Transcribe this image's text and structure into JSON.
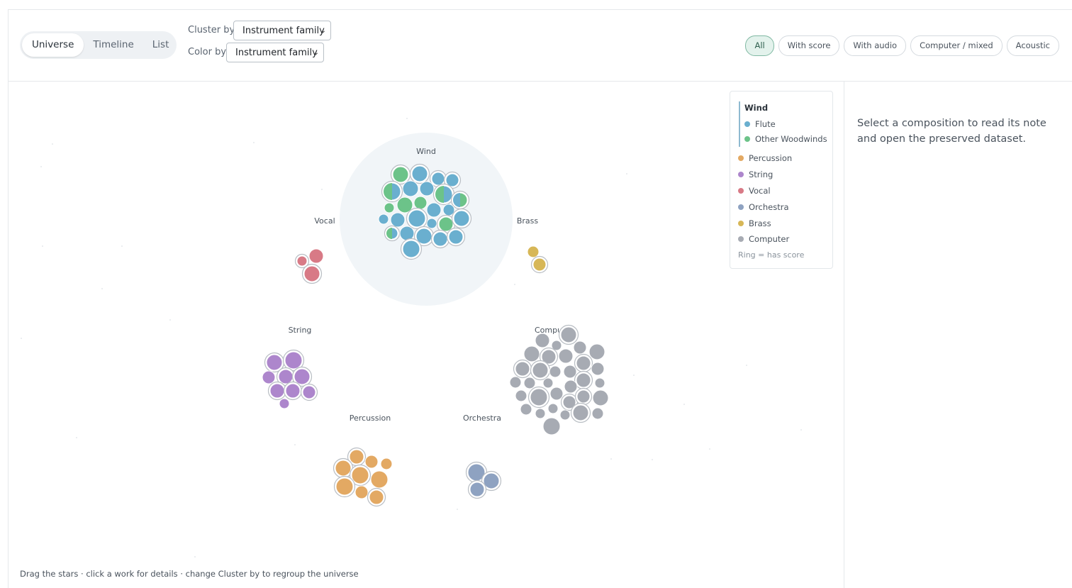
{
  "toolbar": {
    "views": [
      {
        "label": "Universe",
        "active": true
      },
      {
        "label": "Timeline",
        "active": false
      },
      {
        "label": "List",
        "active": false
      }
    ],
    "cluster_by": {
      "label": "Cluster by",
      "value": "Instrument family"
    },
    "color_by": {
      "label": "Color by",
      "value": "Instrument family"
    },
    "filters": [
      {
        "label": "All",
        "active": true
      },
      {
        "label": "With score",
        "active": false
      },
      {
        "label": "With audio",
        "active": false
      },
      {
        "label": "Computer / mixed",
        "active": false
      },
      {
        "label": "Acoustic",
        "active": false
      }
    ]
  },
  "colors": {
    "flute": "#6aafcf",
    "other_woodwinds": "#6cc389",
    "percussion": "#e3a963",
    "string": "#ad86cc",
    "vocal": "#d87a86",
    "orchestra": "#8ea2c1",
    "brass": "#d7b757",
    "computer": "#a7abb3"
  },
  "clusters": {
    "wind": "Wind",
    "vocal": "Vocal",
    "brass": "Brass",
    "string": "String",
    "computer": "Computer",
    "percussion": "Percussion",
    "orchestra": "Orchestra"
  },
  "legend": {
    "group_title": "Wind",
    "flute": "Flute",
    "other_woodwinds": "Other Woodwinds",
    "percussion": "Percussion",
    "string": "String",
    "vocal": "Vocal",
    "orchestra": "Orchestra",
    "brass": "Brass",
    "computer": "Computer",
    "note": "Ring = has score"
  },
  "detail_panel": {
    "message": "Select a composition to read its note and open the preserved dataset."
  },
  "hint": "Drag the stars · click a work for details · change Cluster by to regroup the universe"
}
